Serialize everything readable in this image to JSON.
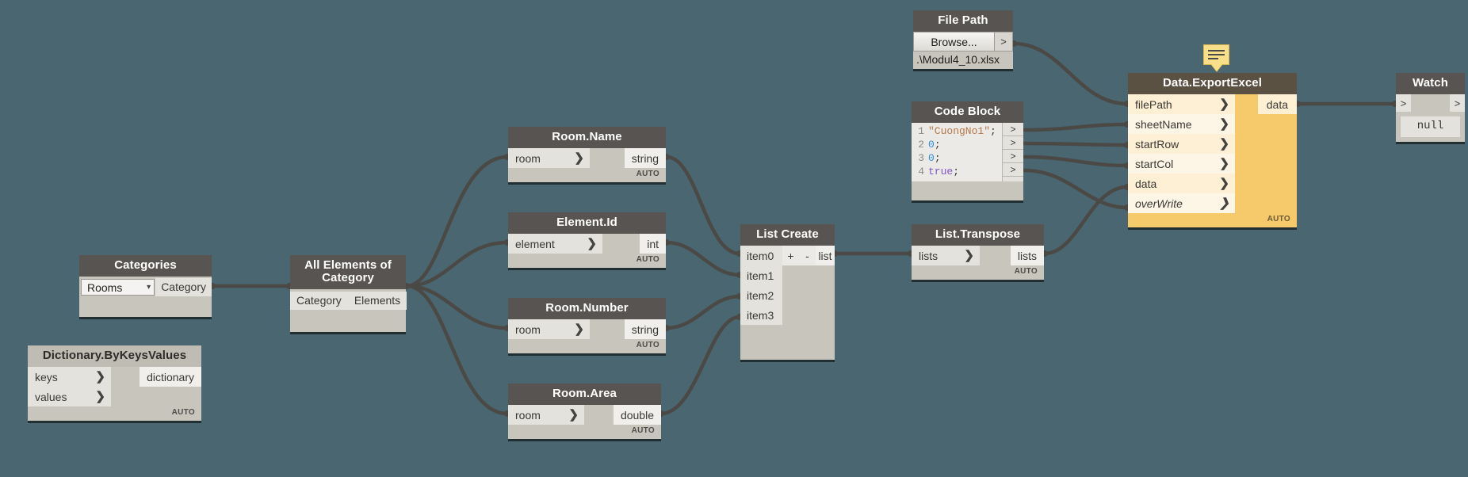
{
  "canvas": {
    "background": "#4a6670"
  },
  "nodes": {
    "categories": {
      "title": "Categories",
      "selected_value": "Rooms",
      "output_label": "Category",
      "dropdown_icon": "chevron-down-icon"
    },
    "all_elements_of_category": {
      "title": "All Elements of Category",
      "input_label": "Category",
      "output_label": "Elements"
    },
    "dictionary_by_keys_values": {
      "title": "Dictionary.ByKeysValues",
      "inputs": [
        "keys",
        "values"
      ],
      "output_label": "dictionary",
      "footer": "AUTO"
    },
    "room_name": {
      "title": "Room.Name",
      "input_label": "room",
      "output_label": "string",
      "footer": "AUTO"
    },
    "element_id": {
      "title": "Element.Id",
      "input_label": "element",
      "output_label": "int",
      "footer": "AUTO"
    },
    "room_number": {
      "title": "Room.Number",
      "input_label": "room",
      "output_label": "string",
      "footer": "AUTO"
    },
    "room_area": {
      "title": "Room.Area",
      "input_label": "room",
      "output_label": "double",
      "footer": "AUTO"
    },
    "list_create": {
      "title": "List Create",
      "items": [
        "item0",
        "item1",
        "item2",
        "item3"
      ],
      "add_label": "+",
      "remove_label": "-",
      "output_label": "list"
    },
    "list_transpose": {
      "title": "List.Transpose",
      "input_label": "lists",
      "output_label": "lists",
      "footer": "AUTO"
    },
    "file_path": {
      "title": "File Path",
      "browse_label": "Browse...",
      "port_caret": ">",
      "path_value": ".\\Modul4_10.xlsx"
    },
    "code_block": {
      "title": "Code Block",
      "lines": [
        {
          "num": "1",
          "value": "\"CuongNo1\"",
          "type": "string",
          "terminator": ";"
        },
        {
          "num": "2",
          "value": "0",
          "type": "number",
          "terminator": ";"
        },
        {
          "num": "3",
          "value": "0",
          "type": "number",
          "terminator": ";"
        },
        {
          "num": "4",
          "value": "true",
          "type": "boolean",
          "terminator": ";"
        }
      ],
      "port_caret": ">"
    },
    "data_export_excel": {
      "title": "Data.ExportExcel",
      "inputs": [
        "filePath",
        "sheetName",
        "startRow",
        "startCol",
        "data",
        "overWrite"
      ],
      "output_label": "data",
      "footer": "AUTO",
      "accent_color": "#f6c96a",
      "header_color": "#5a5142"
    },
    "watch": {
      "title": "Watch",
      "in_caret": ">",
      "out_caret": ">",
      "value": "null"
    }
  },
  "note_balloon": {
    "icon": "note-icon"
  }
}
